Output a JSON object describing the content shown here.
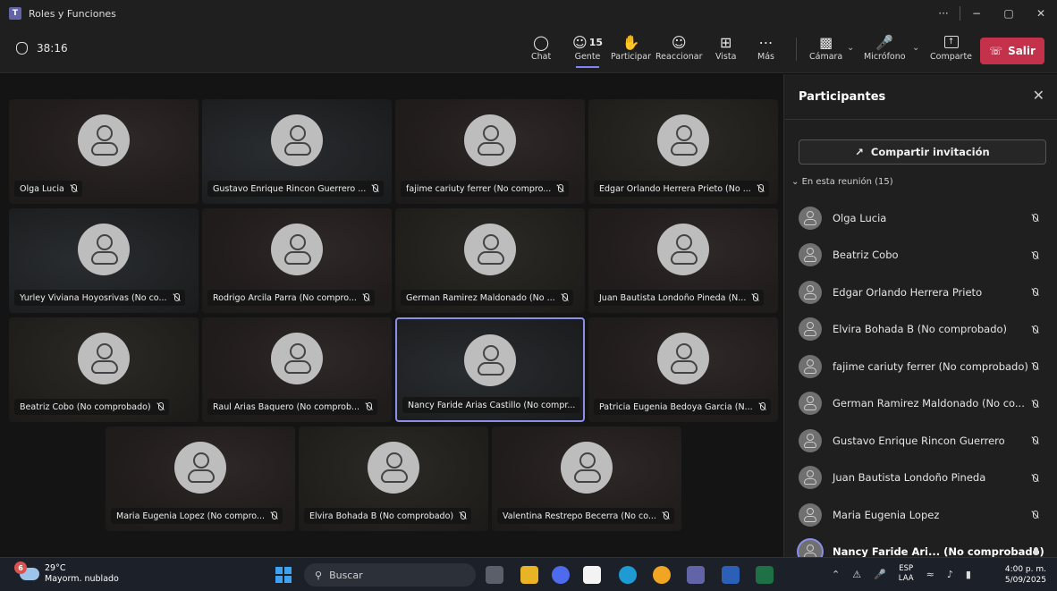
{
  "window": {
    "title": "Roles y Funciones",
    "controls": [
      "···",
      "−",
      "▢",
      "✕"
    ]
  },
  "meeting": {
    "timer": "38:16",
    "tools": [
      {
        "label": "Chat",
        "icon": "chat-icon"
      },
      {
        "label": "Gente",
        "icon": "people-icon",
        "count": "15"
      },
      {
        "label": "Participar",
        "icon": "raise-hand-icon"
      },
      {
        "label": "Reaccionar",
        "icon": "emoji-icon"
      },
      {
        "label": "Vista",
        "icon": "grid-view-icon"
      },
      {
        "label": "Más",
        "icon": "more-icon"
      }
    ],
    "camera_label": "Cámara",
    "mic_label": "Micrófono",
    "share_label": "Comparte",
    "leave_label": "Salir"
  },
  "tiles": [
    {
      "name": "Olga Lucia"
    },
    {
      "name": "Gustavo Enrique Rincon Guerrero ..."
    },
    {
      "name": "fajime cariuty ferrer (No compro..."
    },
    {
      "name": "Edgar Orlando Herrera Prieto (No ..."
    },
    {
      "name": "Yurley Viviana Hoyosrivas (No co..."
    },
    {
      "name": "Rodrigo Arcila Parra (No compro..."
    },
    {
      "name": "German Ramirez Maldonado (No ..."
    },
    {
      "name": "Juan Bautista Londoño Pineda (N..."
    },
    {
      "name": "Beatriz Cobo (No comprobado)"
    },
    {
      "name": "Raul Arias Baquero (No comprob..."
    },
    {
      "name": "Nancy Faride Arias Castillo (No compr..."
    },
    {
      "name": "Patricia Eugenia Bedoya Garcia (N..."
    },
    {
      "name": "Maria Eugenia Lopez (No compro..."
    },
    {
      "name": "Elvira Bohada B (No comprobado)"
    },
    {
      "name": "Valentina Restrepo Becerra (No co..."
    }
  ],
  "panel": {
    "title": "Participantes",
    "invite_label": "Compartir invitación",
    "section_label": "En esta reunión (15)",
    "participants": [
      {
        "name": "Olga Lucia"
      },
      {
        "name": "Beatriz Cobo"
      },
      {
        "name": "Edgar Orlando Herrera Prieto"
      },
      {
        "name": "Elvira Bohada B (No comprobado)"
      },
      {
        "name": "fajime cariuty ferrer (No comprobado)"
      },
      {
        "name": "German Ramirez Maldonado (No co..."
      },
      {
        "name": "Gustavo Enrique Rincon Guerrero"
      },
      {
        "name": "Juan Bautista Londoño Pineda"
      },
      {
        "name": "Maria Eugenia Lopez"
      },
      {
        "name": "Nancy Faride Ari... (No comprobado)"
      }
    ]
  },
  "taskbar": {
    "weather_badge": "6",
    "temperature": "29°C",
    "weather_desc": "Mayorm. nublado",
    "search_label": "Buscar",
    "lang_top": "ESP",
    "lang_bottom": "LAA",
    "time": "4:00 p. m.",
    "date": "5/09/2025"
  },
  "colors": {
    "leave": "#c4314b",
    "accent": "#7f85f5",
    "speaking_ring": "#8b8fe8"
  }
}
